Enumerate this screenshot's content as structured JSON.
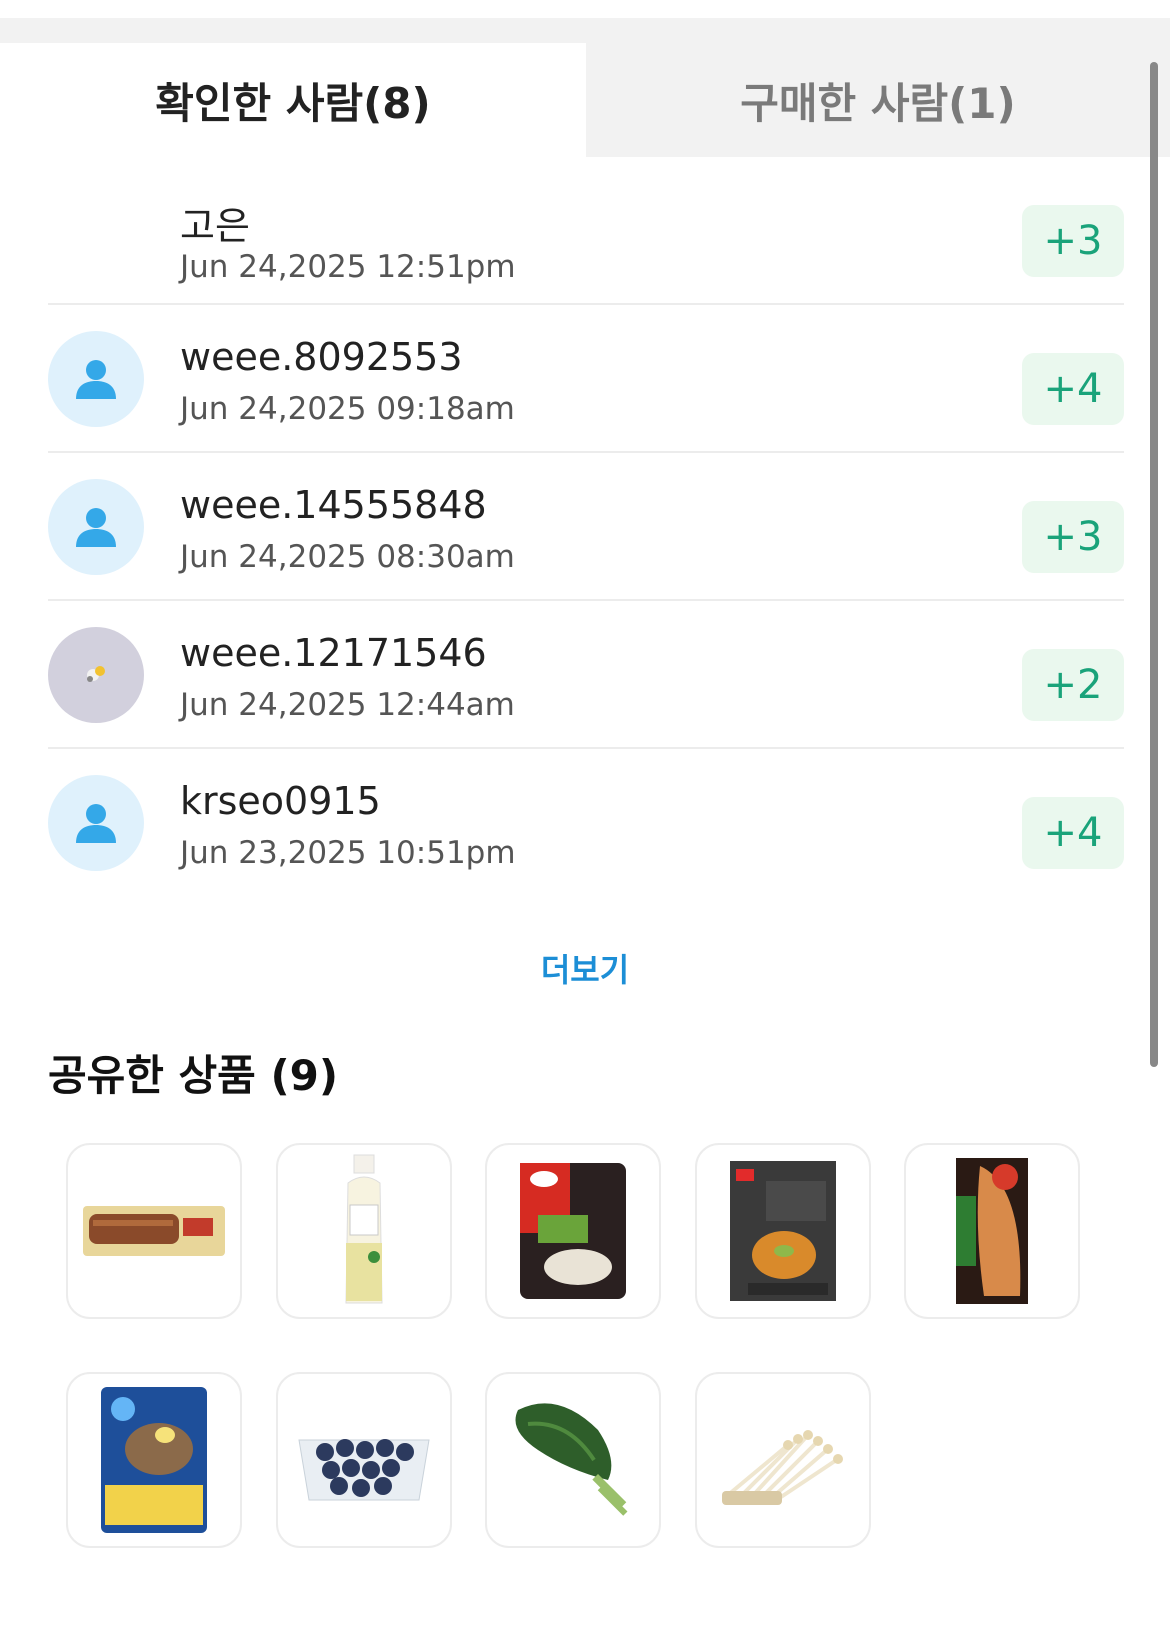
{
  "tabs": [
    {
      "label": "확인한 사람(8)",
      "active": true
    },
    {
      "label": "구매한 사람(1)",
      "active": false
    }
  ],
  "viewers": [
    {
      "name": "고은",
      "time": "Jun 24,2025 12:51pm",
      "badge": "+3",
      "avatar": "none"
    },
    {
      "name": "weee.8092553",
      "time": "Jun 24,2025 09:18am",
      "badge": "+4",
      "avatar": "person-icon"
    },
    {
      "name": "weee.14555848",
      "time": "Jun 24,2025 08:30am",
      "badge": "+3",
      "avatar": "person-icon"
    },
    {
      "name": "weee.12171546",
      "time": "Jun 24,2025 12:44am",
      "badge": "+2",
      "avatar": "photo"
    },
    {
      "name": "krseo0915",
      "time": "Jun 23,2025 10:51pm",
      "badge": "+4",
      "avatar": "person-icon"
    }
  ],
  "more_label": "더보기",
  "shared_title": "공유한 상품 (9)",
  "products": [
    {
      "icon": "grilled-eel-icon"
    },
    {
      "icon": "vinegar-bottle-icon"
    },
    {
      "icon": "soup-pack-icon"
    },
    {
      "icon": "kimchi-stew-pack-icon"
    },
    {
      "icon": "grilled-mackerel-icon"
    },
    {
      "icon": "cold-noodles-pack-icon"
    },
    {
      "icon": "blueberries-icon"
    },
    {
      "icon": "kale-icon"
    },
    {
      "icon": "enoki-mushroom-icon"
    }
  ],
  "colors": {
    "accent": "#1aa37a",
    "link": "#1c8ed6",
    "badge_bg": "#eaf8ee",
    "avatar_bg": "#dff1fc"
  }
}
